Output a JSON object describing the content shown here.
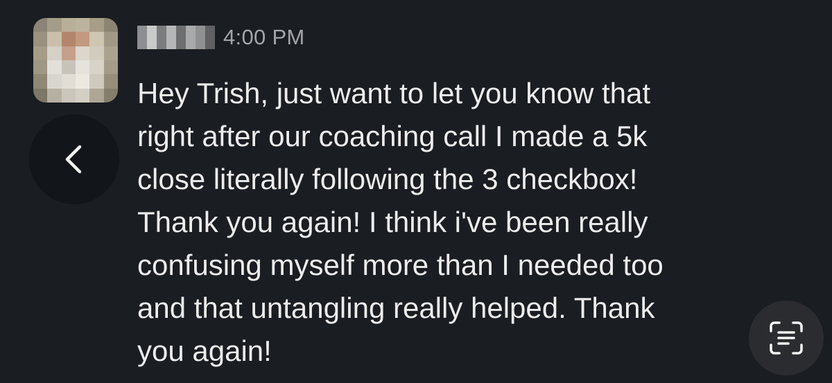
{
  "message": {
    "timestamp": "4:00 PM",
    "lines": [
      "Hey Trish, just want to let you know that",
      "right after our coaching call I made a 5k",
      "close literally following the 3 checkbox!",
      "Thank you again! I think i've been really",
      "confusing myself more than I needed too",
      "and that untangling really helped. Thank",
      "you again!"
    ]
  },
  "icons": {
    "back": "chevron-left-icon",
    "live_text": "text-scan-icon"
  },
  "colors": {
    "background": "#1a1d21",
    "message_text": "#ececec",
    "timestamp_text": "#a3a5a8"
  }
}
